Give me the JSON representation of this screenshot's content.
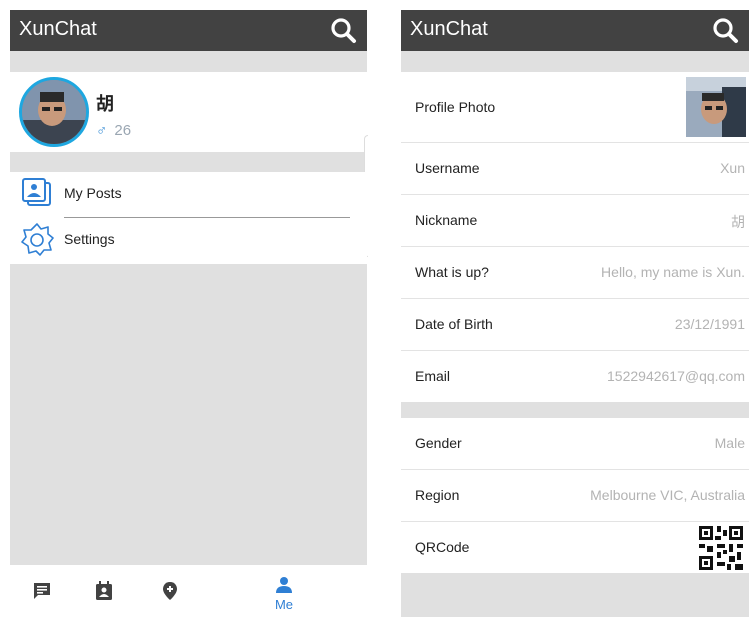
{
  "left_screen": {
    "app_title": "XunChat",
    "profile": {
      "name": "胡",
      "gender_symbol": "♂",
      "age": "26"
    },
    "menu": [
      {
        "label": "My Posts",
        "icon": "photos-icon"
      },
      {
        "label": "Settings",
        "icon": "gear-icon"
      }
    ],
    "bottom_nav": [
      {
        "icon": "chat-icon",
        "label": ""
      },
      {
        "icon": "contacts-icon",
        "label": ""
      },
      {
        "icon": "location-icon",
        "label": ""
      },
      {
        "icon": "person-icon",
        "label": "Me",
        "active": true
      }
    ]
  },
  "right_screen": {
    "app_title": "XunChat",
    "rows": [
      {
        "label": "Profile Photo",
        "value": ""
      },
      {
        "label": "Username",
        "value": "Xun"
      },
      {
        "label": "Nickname",
        "value": "胡"
      },
      {
        "label": "What is up?",
        "value": "Hello, my name is Xun."
      },
      {
        "label": "Date of Birth",
        "value": "23/12/1991"
      },
      {
        "label": "Email",
        "value": "1522942617@qq.com"
      },
      {
        "label": "Gender",
        "value": "Male"
      },
      {
        "label": "Region",
        "value": "Melbourne VIC, Australia"
      },
      {
        "label": "QRCode",
        "value": ""
      }
    ]
  },
  "colors": {
    "appbar": "#424242",
    "background": "#e0e0e0",
    "accent_blue": "#2f7fd4",
    "avatar_ring": "#1ea7e0",
    "value_text": "#b3b3b3"
  }
}
